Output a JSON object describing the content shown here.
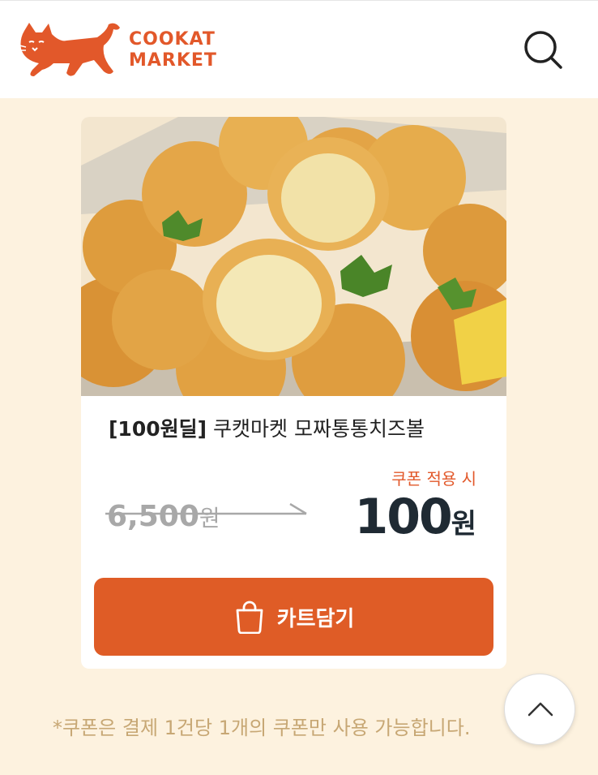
{
  "header": {
    "logo_line1": "COOKAT",
    "logo_line2": "MARKET",
    "brand_color": "#e2582a",
    "search_icon": "search-icon"
  },
  "product": {
    "deal_tag": "[100원딜]",
    "name": "쿠캣마켓 모짜통통치즈볼",
    "coupon_label": "쿠폰 적용 시",
    "original_price": "6,500",
    "original_unit": "원",
    "sale_price": "100",
    "sale_unit": "원",
    "image_alt": "cheese balls"
  },
  "cart_button": {
    "label": "카트담기",
    "icon": "shopping-bag-icon",
    "color": "#df5c26"
  },
  "notice": {
    "text": "*쿠폰은 결제 1건당 1개의 쿠폰만 사용 가능합니다."
  },
  "scroll_top": {
    "icon": "chevron-up-icon"
  }
}
